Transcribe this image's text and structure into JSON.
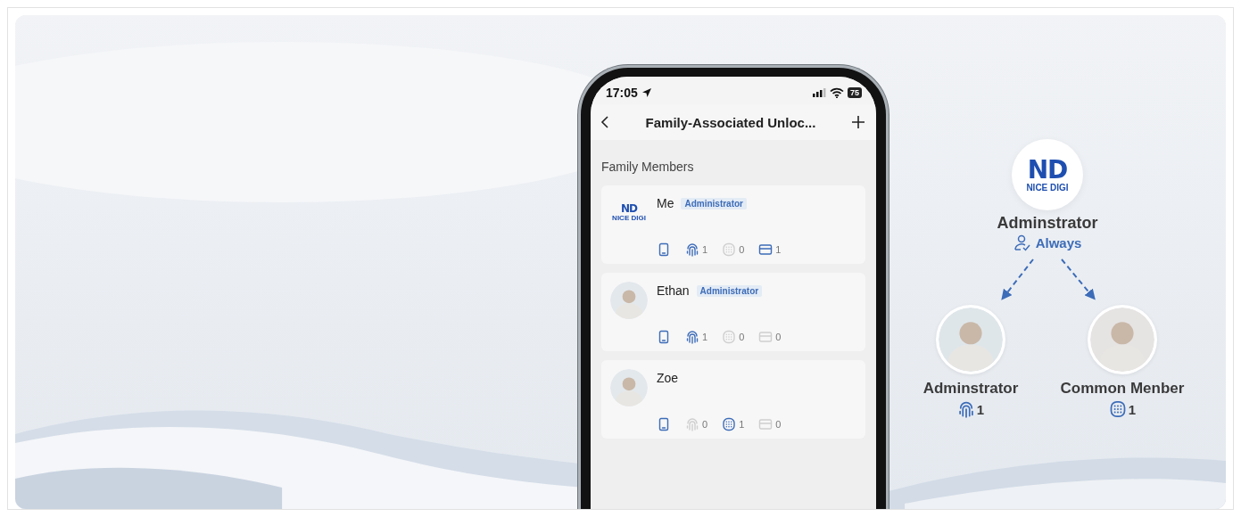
{
  "status_bar": {
    "time": "17:05",
    "battery": "75"
  },
  "header": {
    "title": "Family-Associated Unloc..."
  },
  "section_title": "Family Members",
  "members": [
    {
      "name": "Me",
      "logo": {
        "mark": "ND",
        "text": "NICE DIGI"
      },
      "role": "Administrator",
      "credentials": [
        {
          "kind": "phone",
          "active": true
        },
        {
          "kind": "fingerprint",
          "count": "1",
          "active": true
        },
        {
          "kind": "keypad",
          "count": "0",
          "active": false
        },
        {
          "kind": "card",
          "count": "1",
          "active": true
        }
      ]
    },
    {
      "name": "Ethan",
      "role": "Administrator",
      "credentials": [
        {
          "kind": "phone",
          "active": true
        },
        {
          "kind": "fingerprint",
          "count": "1",
          "active": true
        },
        {
          "kind": "keypad",
          "count": "0",
          "active": false
        },
        {
          "kind": "card",
          "count": "0",
          "active": false
        }
      ]
    },
    {
      "name": "Zoe",
      "credentials": [
        {
          "kind": "phone",
          "active": true
        },
        {
          "kind": "fingerprint",
          "count": "0",
          "active": false
        },
        {
          "kind": "keypad",
          "count": "1",
          "active": true
        },
        {
          "kind": "card",
          "count": "0",
          "active": false
        }
      ]
    }
  ],
  "diagram": {
    "root": {
      "logo_mark": "ND",
      "logo_text": "NICE DIGI",
      "role": "Adminstrator",
      "permission": "Always"
    },
    "children": [
      {
        "avatar": {
          "kind": "picture"
        },
        "role": "Adminstrator",
        "credential": {
          "kind": "fingerprint",
          "count": "1"
        }
      },
      {
        "avatar": {
          "kind": "picture"
        },
        "role": "Common Menber",
        "credential": {
          "kind": "keypad",
          "count": "1"
        }
      }
    ]
  }
}
